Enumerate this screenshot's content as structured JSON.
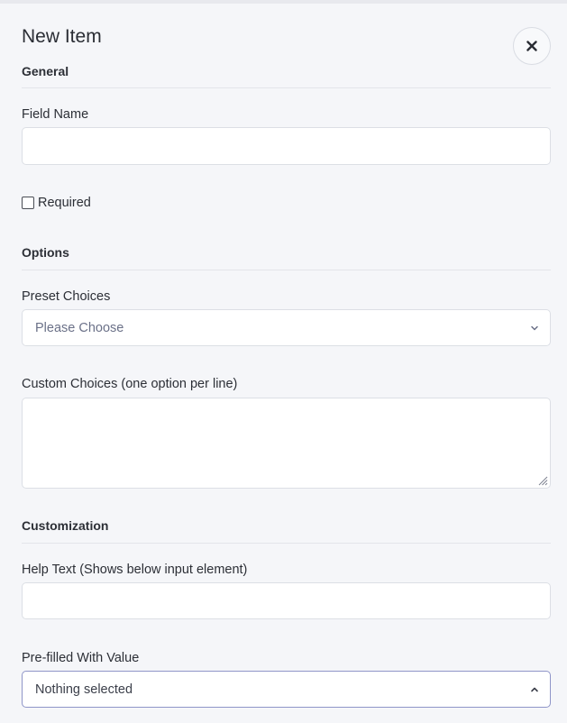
{
  "dialog": {
    "title": "New Item"
  },
  "sections": {
    "general": "General",
    "options": "Options",
    "customization": "Customization"
  },
  "fields": {
    "field_name": {
      "label": "Field Name",
      "value": ""
    },
    "required": {
      "label": "Required",
      "checked": false
    },
    "preset_choices": {
      "label": "Preset Choices",
      "selected": "Please Choose"
    },
    "custom_choices": {
      "label": "Custom Choices (one option per line)",
      "value": ""
    },
    "help_text": {
      "label": "Help Text (Shows below input element)",
      "value": ""
    },
    "prefilled": {
      "label": "Pre-filled With Value",
      "selected": "Nothing selected"
    }
  },
  "icons": {
    "close": "close-icon",
    "chevron_down": "chevron-down-icon",
    "chevron_up": "chevron-up-icon",
    "resize": "resize-grip-icon"
  },
  "colors": {
    "panel_bg": "#f5f6f9",
    "input_border": "#dcdfe5",
    "active_border": "#8f95c8",
    "placeholder_text": "#6b7188"
  }
}
